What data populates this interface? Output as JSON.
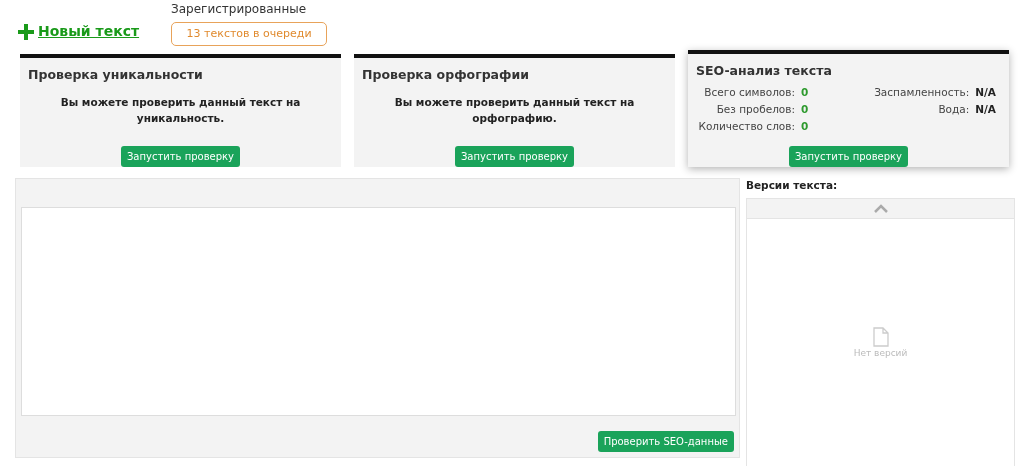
{
  "header": {
    "new_text_link": "Новый текст",
    "queue_label": "Зарегистрированные",
    "queue_button": "13 текстов в очереди"
  },
  "cards": [
    {
      "kind": "message",
      "title": "Проверка уникальности",
      "message": "Вы можете проверить данный текст на уникальность.",
      "button": "Запустить проверку"
    },
    {
      "kind": "message",
      "title": "Проверка орфографии",
      "message": "Вы можете проверить данный текст на орфографию.",
      "button": "Запустить проверку"
    },
    {
      "kind": "stats",
      "title": "SEO-анализ текста",
      "button": "Запустить проверку",
      "stats_left": [
        {
          "label": "Всего символов:",
          "value": "0",
          "color": "#2e9a2e"
        },
        {
          "label": "Без пробелов:",
          "value": "0",
          "color": "#2e9a2e"
        },
        {
          "label": "Количество слов:",
          "value": "0",
          "color": "#2e9a2e"
        }
      ],
      "stats_right": [
        {
          "label": "Заспамленность:",
          "value": "N/A",
          "color": "#222222"
        },
        {
          "label": "Вода:",
          "value": "N/A",
          "color": "#222222"
        }
      ]
    }
  ],
  "editor": {
    "button": "Проверить SEO-данные"
  },
  "versions": {
    "label": "Версии текста:",
    "empty_text": "Нет версий"
  }
}
